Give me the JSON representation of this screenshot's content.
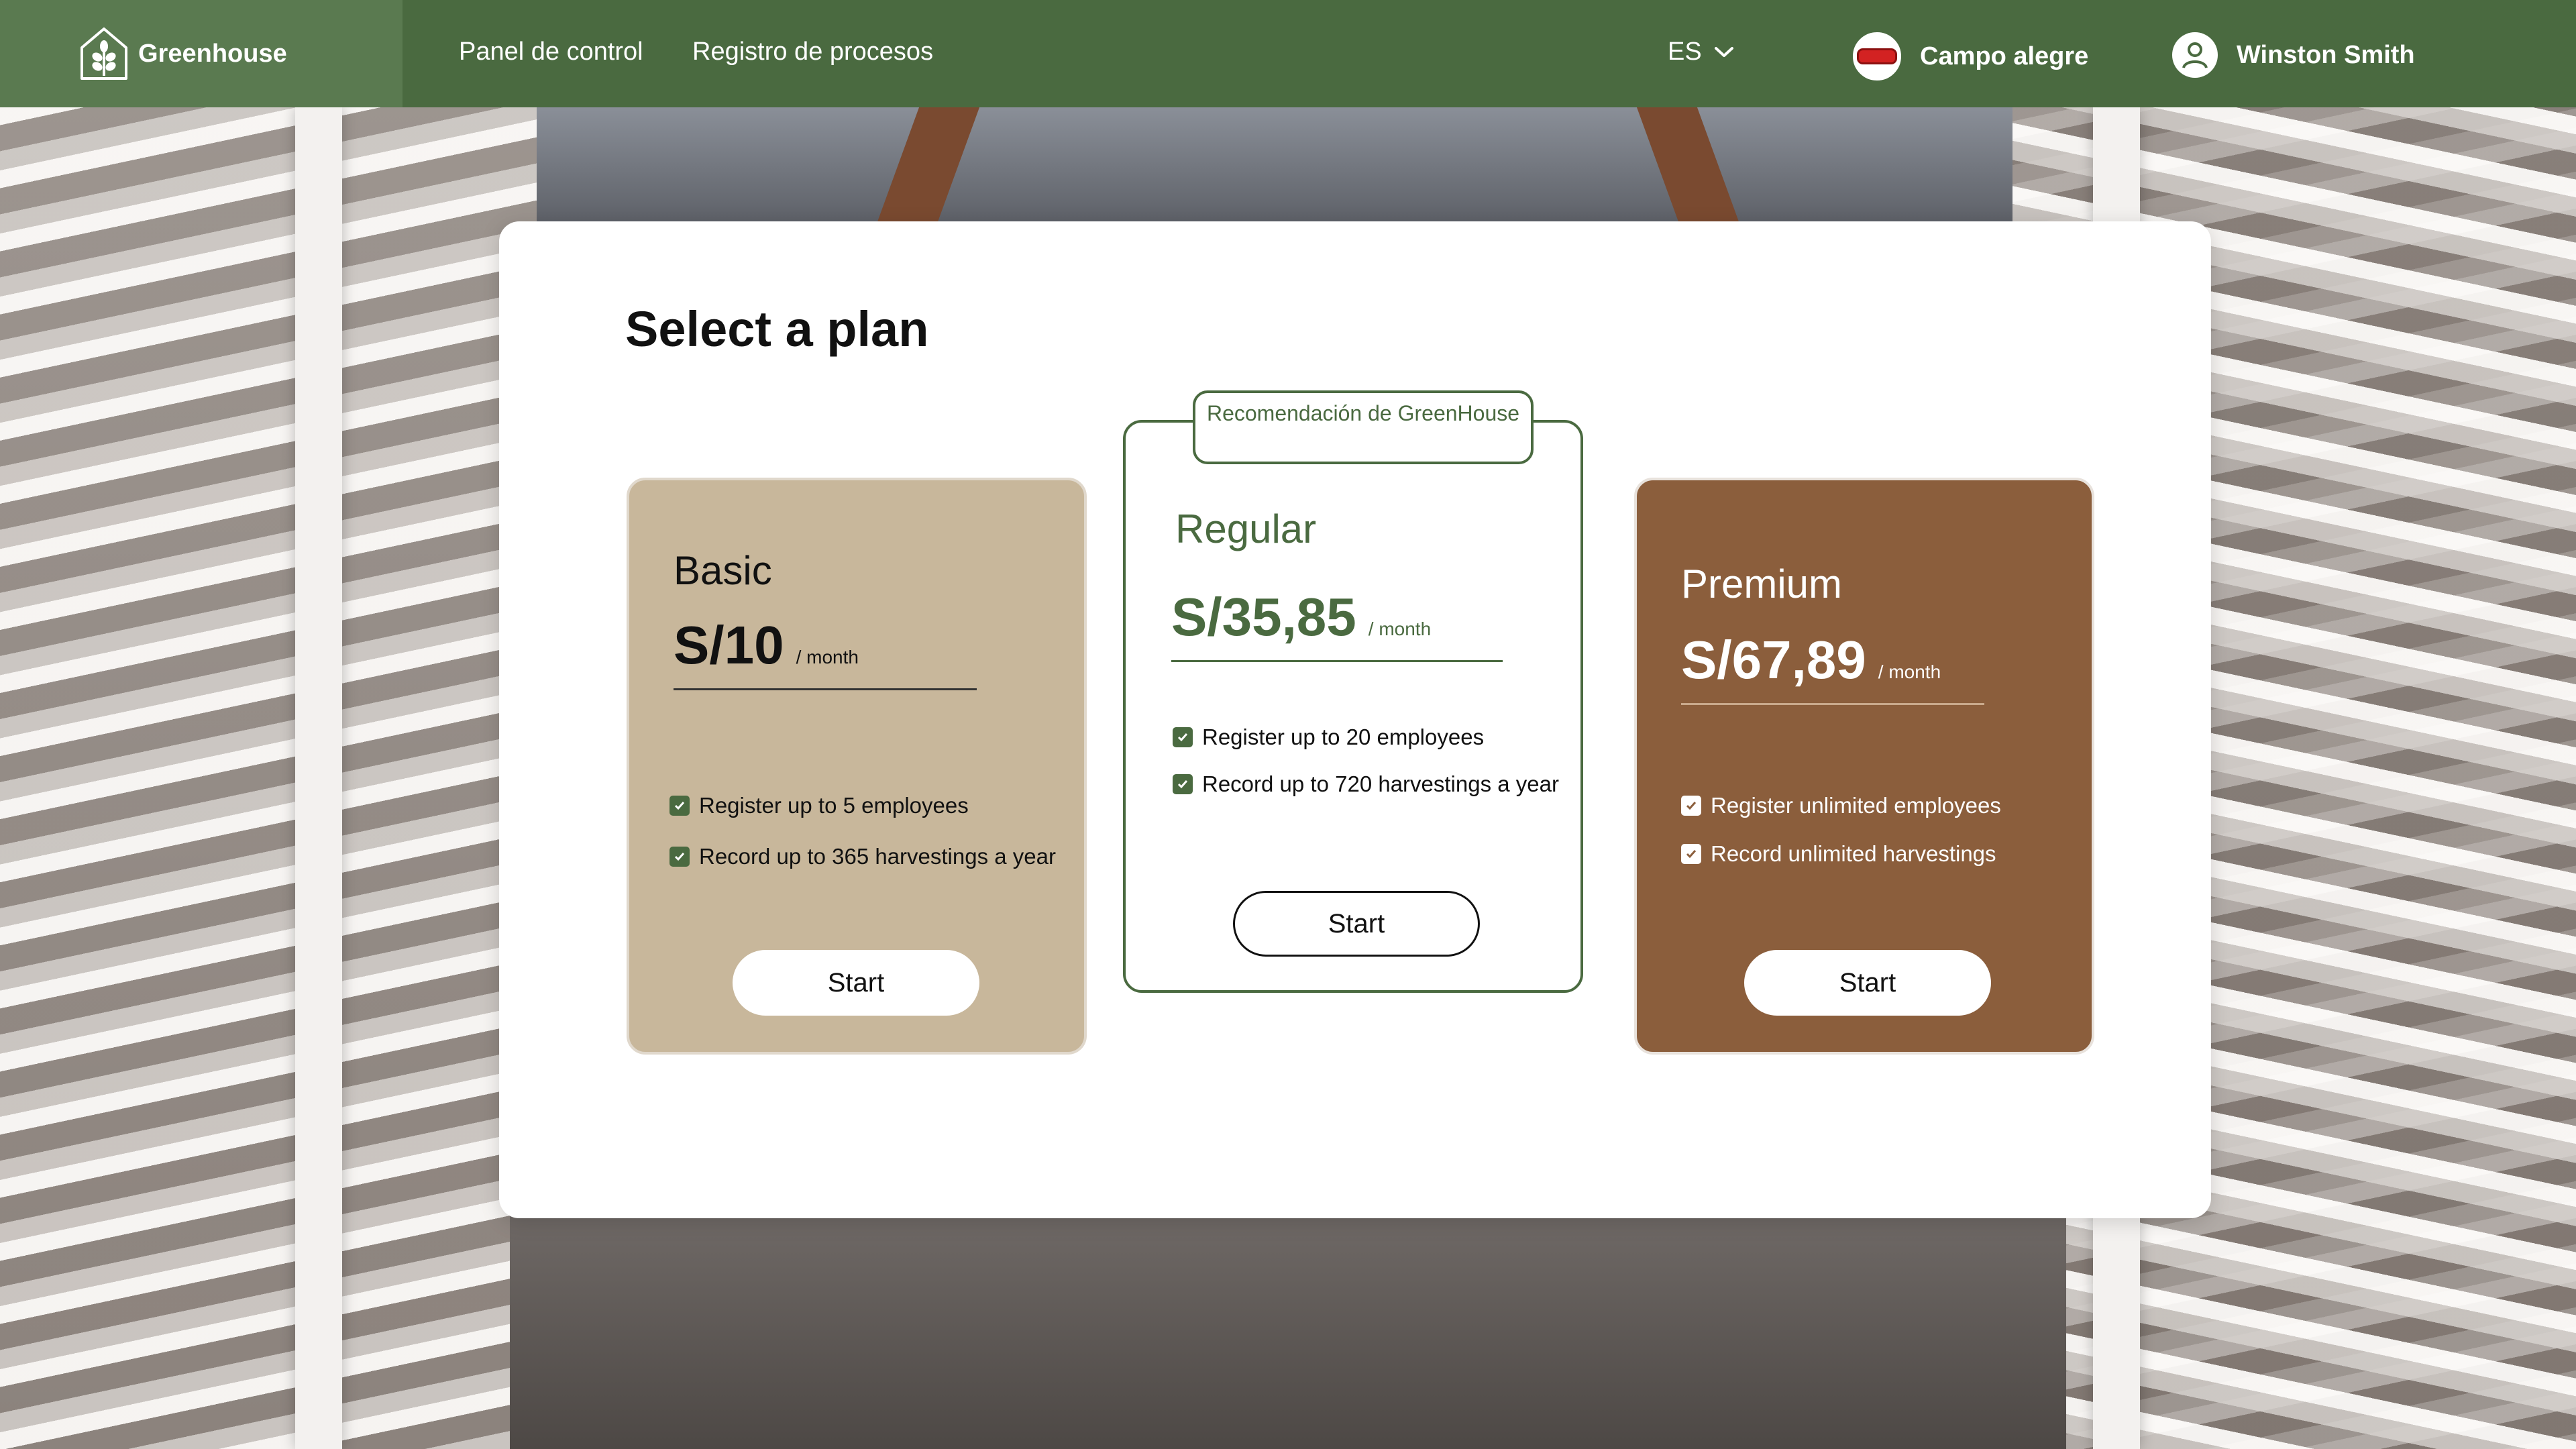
{
  "app": {
    "brand_name": "Greenhouse",
    "brand_icon": "greenhouse-leaf-icon",
    "accent_color": "#4a6a40"
  },
  "nav": {
    "items": [
      {
        "label": "Panel de control"
      },
      {
        "label": "Registro de procesos"
      }
    ],
    "language": {
      "selected": "ES",
      "icon": "chevron-down-icon"
    },
    "farm": {
      "name": "Campo alegre",
      "icon": "farm-badge-icon"
    },
    "user": {
      "name": "Winston Smith",
      "icon": "user-avatar-icon"
    }
  },
  "main": {
    "title": "Select a plan",
    "recommendation_badge": "Recomendación de GreenHouse",
    "plans": [
      {
        "name": "Basic",
        "price": "S/10",
        "period": "/ month",
        "color": "#c8b79b",
        "features": [
          "Register up to 5 employees",
          "Record up to 365 harvestings a year"
        ],
        "cta": "Start"
      },
      {
        "name": "Regular",
        "price": "S/35,85",
        "period": "/ month",
        "color": "#ffffff",
        "features": [
          "Register  up to 20 employees",
          "Record up to 720 harvestings a year"
        ],
        "cta": "Start",
        "recommended": true
      },
      {
        "name": "Premium",
        "price": "S/67,89",
        "period": "/ month",
        "color": "#8b5e3c",
        "features": [
          "Register unlimited employees",
          "Record unlimited harvestings"
        ],
        "cta": "Start"
      }
    ]
  }
}
